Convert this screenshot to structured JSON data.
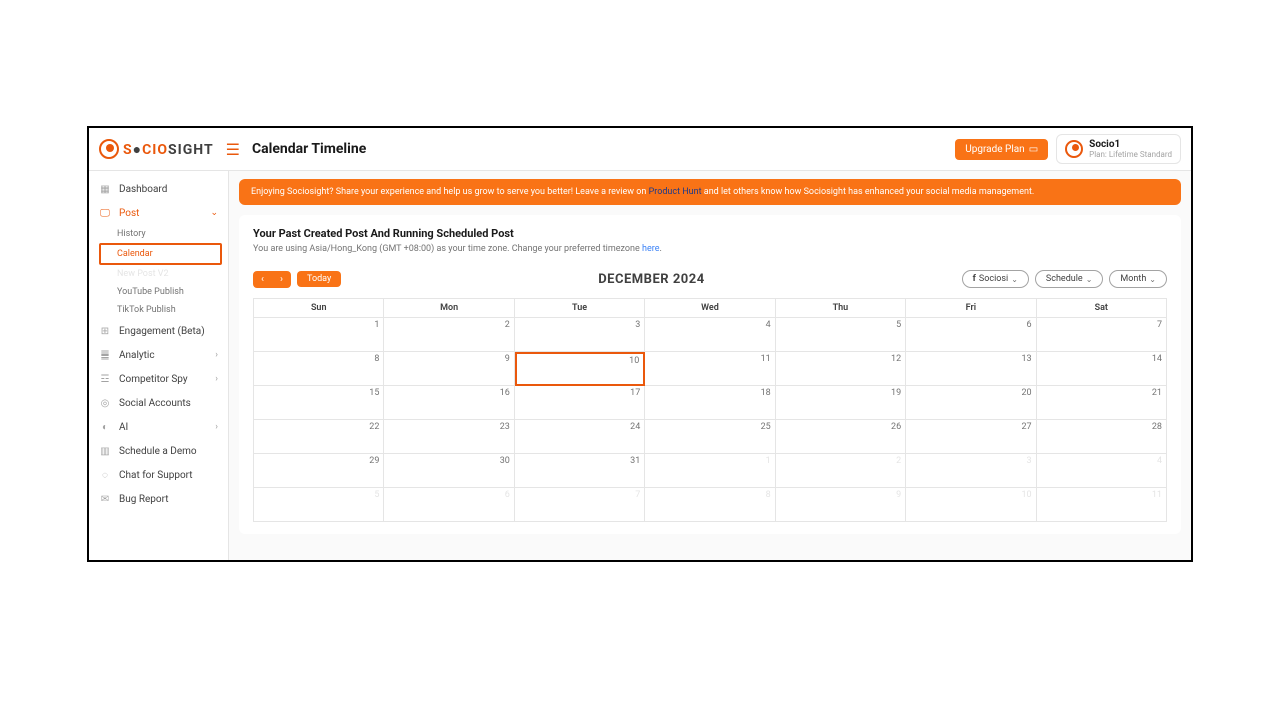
{
  "header": {
    "logo_part1": "S",
    "logo_part2": "CIO",
    "logo_part3": "SIGHT",
    "page_title": "Calendar Timeline",
    "upgrade_label": "Upgrade Plan",
    "account_name": "Socio1",
    "account_plan": "Plan: Lifetime Standard"
  },
  "sidebar": {
    "dashboard": "Dashboard",
    "post": "Post",
    "post_sub": {
      "history": "History",
      "calendar": "Calendar",
      "newpostv2": "New Post V2",
      "youtube": "YouTube Publish",
      "tiktok": "TikTok Publish"
    },
    "engagement": "Engagement (Beta)",
    "analytic": "Analytic",
    "competitor": "Competitor Spy",
    "social_accounts": "Social Accounts",
    "ai": "AI",
    "schedule_demo": "Schedule a Demo",
    "chat_support": "Chat for Support",
    "bug_report": "Bug Report"
  },
  "banner": {
    "t1": "Enjoying Sociosight? Share your experience and help us grow to serve you better! Leave a review on ",
    "link": "Product Hunt",
    "t2": " and let others know how Sociosight has enhanced your social media management."
  },
  "card": {
    "title": "Your Past Created Post And Running Scheduled Post",
    "sub1": "You are using Asia/Hong_Kong (GMT +08:00) as your time zone. Change your preferred timezone ",
    "sub_link": "here",
    "sub2": "."
  },
  "toolbar": {
    "today": "Today",
    "month_label": "DECEMBER 2024",
    "filter_account": "Sociosi",
    "filter_schedule": "Schedule",
    "filter_view": "Month"
  },
  "calendar": {
    "days": [
      "Sun",
      "Mon",
      "Tue",
      "Wed",
      "Thu",
      "Fri",
      "Sat"
    ],
    "weeks": [
      [
        {
          "n": "1"
        },
        {
          "n": "2"
        },
        {
          "n": "3"
        },
        {
          "n": "4"
        },
        {
          "n": "5"
        },
        {
          "n": "6"
        },
        {
          "n": "7"
        }
      ],
      [
        {
          "n": "8"
        },
        {
          "n": "9"
        },
        {
          "n": "10",
          "today": true
        },
        {
          "n": "11"
        },
        {
          "n": "12"
        },
        {
          "n": "13"
        },
        {
          "n": "14"
        }
      ],
      [
        {
          "n": "15"
        },
        {
          "n": "16"
        },
        {
          "n": "17"
        },
        {
          "n": "18"
        },
        {
          "n": "19"
        },
        {
          "n": "20"
        },
        {
          "n": "21"
        }
      ],
      [
        {
          "n": "22"
        },
        {
          "n": "23"
        },
        {
          "n": "24"
        },
        {
          "n": "25"
        },
        {
          "n": "26"
        },
        {
          "n": "27"
        },
        {
          "n": "28"
        }
      ],
      [
        {
          "n": "29"
        },
        {
          "n": "30"
        },
        {
          "n": "31"
        },
        {
          "n": "1",
          "out": true
        },
        {
          "n": "2",
          "out": true
        },
        {
          "n": "3",
          "out": true
        },
        {
          "n": "4",
          "out": true
        }
      ],
      [
        {
          "n": "5",
          "out": true
        },
        {
          "n": "6",
          "out": true
        },
        {
          "n": "7",
          "out": true
        },
        {
          "n": "8",
          "out": true
        },
        {
          "n": "9",
          "out": true
        },
        {
          "n": "10",
          "out": true
        },
        {
          "n": "11",
          "out": true
        }
      ]
    ]
  }
}
